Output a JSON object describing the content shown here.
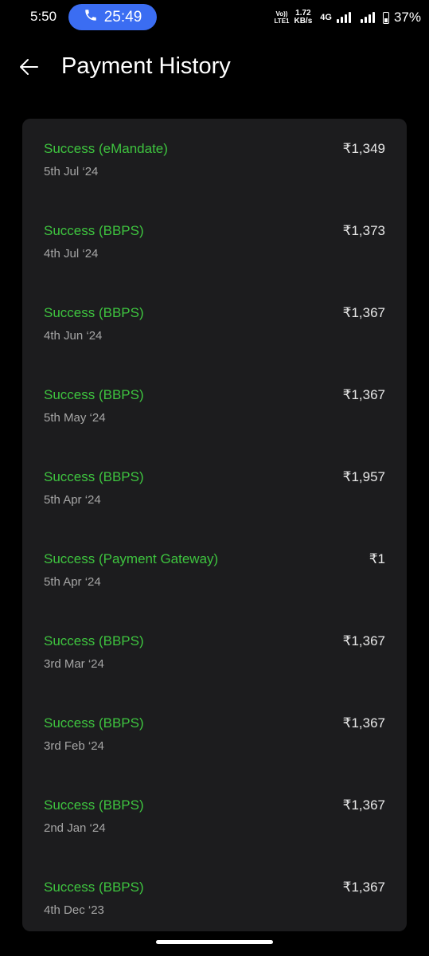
{
  "status_bar": {
    "time": "5:50",
    "call_timer": "25:49",
    "volte_top": "Vo))",
    "volte_bottom": "LTE1",
    "speed_value": "1.72",
    "speed_unit": "KB/s",
    "network_type": "4G",
    "battery": "37%",
    "icons": [
      "phone-icon",
      "signal-icon",
      "signal-icon",
      "battery-icon"
    ]
  },
  "header": {
    "back_icon": "arrow-left-icon",
    "title": "Payment History"
  },
  "payments": [
    {
      "status": "Success (eMandate)",
      "date": "5th Jul  ‘24",
      "amount": "₹1,349"
    },
    {
      "status": "Success (BBPS)",
      "date": "4th Jul  ‘24",
      "amount": "₹1,373"
    },
    {
      "status": "Success (BBPS)",
      "date": "4th Jun  ‘24",
      "amount": "₹1,367"
    },
    {
      "status": "Success (BBPS)",
      "date": "5th May  ‘24",
      "amount": "₹1,367"
    },
    {
      "status": "Success (BBPS)",
      "date": "5th Apr  ‘24",
      "amount": "₹1,957"
    },
    {
      "status": "Success (Payment Gateway)",
      "date": "5th Apr  ‘24",
      "amount": "₹1"
    },
    {
      "status": "Success (BBPS)",
      "date": "3rd Mar  ‘24",
      "amount": "₹1,367"
    },
    {
      "status": "Success (BBPS)",
      "date": "3rd Feb  ‘24",
      "amount": "₹1,367"
    },
    {
      "status": "Success (BBPS)",
      "date": "2nd Jan  ‘24",
      "amount": "₹1,367"
    },
    {
      "status": "Success (BBPS)",
      "date": "4th Dec  ‘23",
      "amount": "₹1,367"
    }
  ],
  "colors": {
    "background": "#000000",
    "card": "#1c1c1e",
    "success_green": "#3ec43f",
    "date_gray": "#a6a6a6",
    "call_pill_blue": "#3b6df2"
  }
}
